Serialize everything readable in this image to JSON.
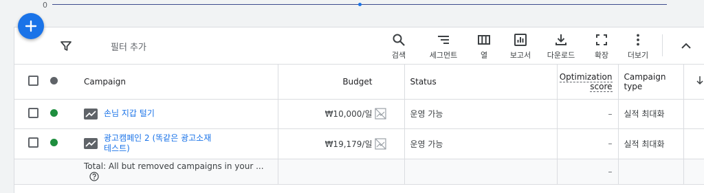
{
  "chart": {
    "zero_label": "0"
  },
  "fab": {
    "icon": "plus-icon"
  },
  "toolbar": {
    "filter_label": "필터 추가",
    "tools": [
      {
        "label": "검색",
        "icon": "search-icon"
      },
      {
        "label": "세그먼트",
        "icon": "segment-icon"
      },
      {
        "label": "열",
        "icon": "columns-icon"
      },
      {
        "label": "보고서",
        "icon": "report-icon"
      },
      {
        "label": "다운로드",
        "icon": "download-icon"
      },
      {
        "label": "확장",
        "icon": "expand-icon"
      },
      {
        "label": "더보기",
        "icon": "more-vert-icon"
      }
    ]
  },
  "table": {
    "headers": {
      "campaign": "Campaign",
      "budget": "Budget",
      "status": "Status",
      "optimization_score": "Optimization score",
      "campaign_type": "Campaign type"
    },
    "rows": [
      {
        "name": "손님 지갑 털기",
        "budget": "₩10,000/일",
        "status": "운영 가능",
        "optimization_score": "–",
        "campaign_type": "실적 최대화",
        "status_color": "#1e8e3e"
      },
      {
        "name": "광고캠페인 2 (똑같은 광고소재 테스트)",
        "budget": "₩19,179/일",
        "status": "운영 가능",
        "optimization_score": "–",
        "campaign_type": "실적 최대화",
        "status_color": "#1e8e3e"
      }
    ],
    "total": {
      "label": "Total: All but removed campaigns in your ...",
      "optimization_score": "–"
    }
  },
  "colors": {
    "accent": "#1a73e8",
    "enabled": "#1e8e3e",
    "header_dot": "#5f6368"
  }
}
